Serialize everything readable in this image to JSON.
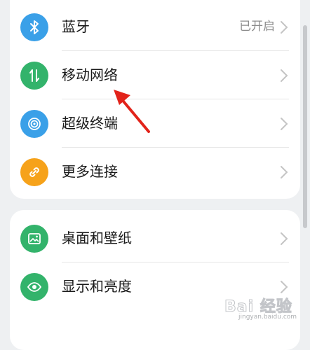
{
  "group1": {
    "items": [
      {
        "label": "蓝牙",
        "value": "已开启",
        "icon": "bluetooth-icon",
        "color": "#3aa0e8"
      },
      {
        "label": "移动网络",
        "value": "",
        "icon": "mobile-network-icon",
        "color": "#33b36b"
      },
      {
        "label": "超级终端",
        "value": "",
        "icon": "super-device-icon",
        "color": "#3aa0e8"
      },
      {
        "label": "更多连接",
        "value": "",
        "icon": "link-icon",
        "color": "#f6a21a"
      }
    ]
  },
  "group2": {
    "items": [
      {
        "label": "桌面和壁纸",
        "value": "",
        "icon": "wallpaper-icon",
        "color": "#33b36b"
      },
      {
        "label": "显示和亮度",
        "value": "",
        "icon": "eye-icon",
        "color": "#33b36b"
      }
    ]
  },
  "annotation": {
    "color": "#e2231a"
  },
  "watermark": {
    "text": "Bai 经验",
    "sub": "jingyan.baidu.com"
  }
}
